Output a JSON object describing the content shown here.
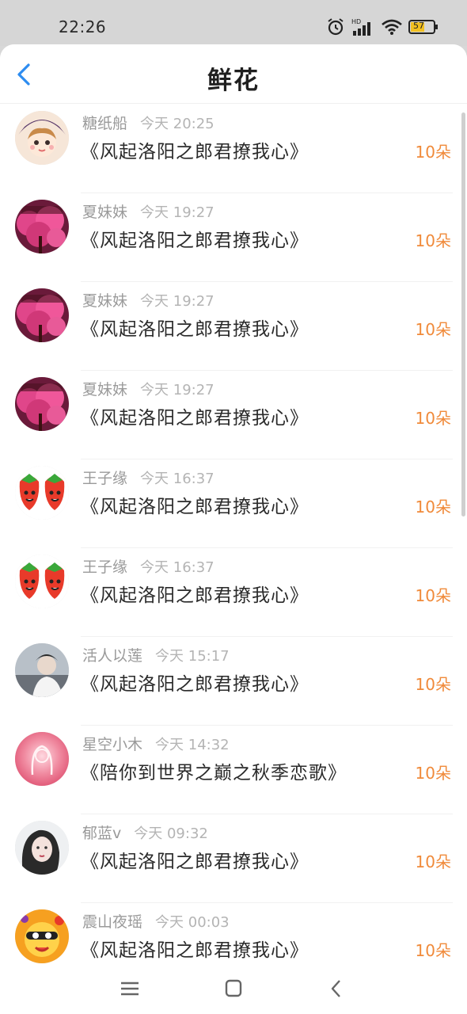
{
  "status_bar": {
    "time": "22:26",
    "battery": "57",
    "icons": [
      "alarm-icon",
      "hd-signal-icon",
      "wifi-icon",
      "battery-icon"
    ]
  },
  "header": {
    "title": "鲜花",
    "back_icon": "chevron-left-icon"
  },
  "colors": {
    "accent": "#2d8cf0",
    "count": "#f08a3a",
    "meta": "#9a9a9a"
  },
  "items": [
    {
      "user": "糖纸船",
      "time": "今天 20:25",
      "book": "《风起洛阳之郎君撩我心》",
      "count": "10朵",
      "avatar": "anime-girl"
    },
    {
      "user": "夏妹妹",
      "time": "今天 19:27",
      "book": "《风起洛阳之郎君撩我心》",
      "count": "10朵",
      "avatar": "pink-tree"
    },
    {
      "user": "夏妹妹",
      "time": "今天 19:27",
      "book": "《风起洛阳之郎君撩我心》",
      "count": "10朵",
      "avatar": "pink-tree"
    },
    {
      "user": "夏妹妹",
      "time": "今天 19:27",
      "book": "《风起洛阳之郎君撩我心》",
      "count": "10朵",
      "avatar": "pink-tree"
    },
    {
      "user": "王子缘",
      "time": "今天 16:37",
      "book": "《风起洛阳之郎君撩我心》",
      "count": "10朵",
      "avatar": "strawberry"
    },
    {
      "user": "王子缘",
      "time": "今天 16:37",
      "book": "《风起洛阳之郎君撩我心》",
      "count": "10朵",
      "avatar": "strawberry"
    },
    {
      "user": "活人以莲",
      "time": "今天 15:17",
      "book": "《风起洛阳之郎君撩我心》",
      "count": "10朵",
      "avatar": "photo-person"
    },
    {
      "user": "星空小木",
      "time": "今天 14:32",
      "book": "《陪你到世界之巅之秋季恋歌》",
      "count": "10朵",
      "avatar": "glow-portrait"
    },
    {
      "user": "郁蓝v",
      "time": "今天 09:32",
      "book": "《风起洛阳之郎君撩我心》",
      "count": "10朵",
      "avatar": "girl-photo"
    },
    {
      "user": "震山夜瑶",
      "time": "今天 00:03",
      "book": "《风起洛阳之郎君撩我心》",
      "count": "10朵",
      "avatar": "cartoon-orange"
    }
  ],
  "nav_bar": {
    "icons": [
      "menu-icon",
      "home-square-icon",
      "back-triangle-icon"
    ]
  }
}
